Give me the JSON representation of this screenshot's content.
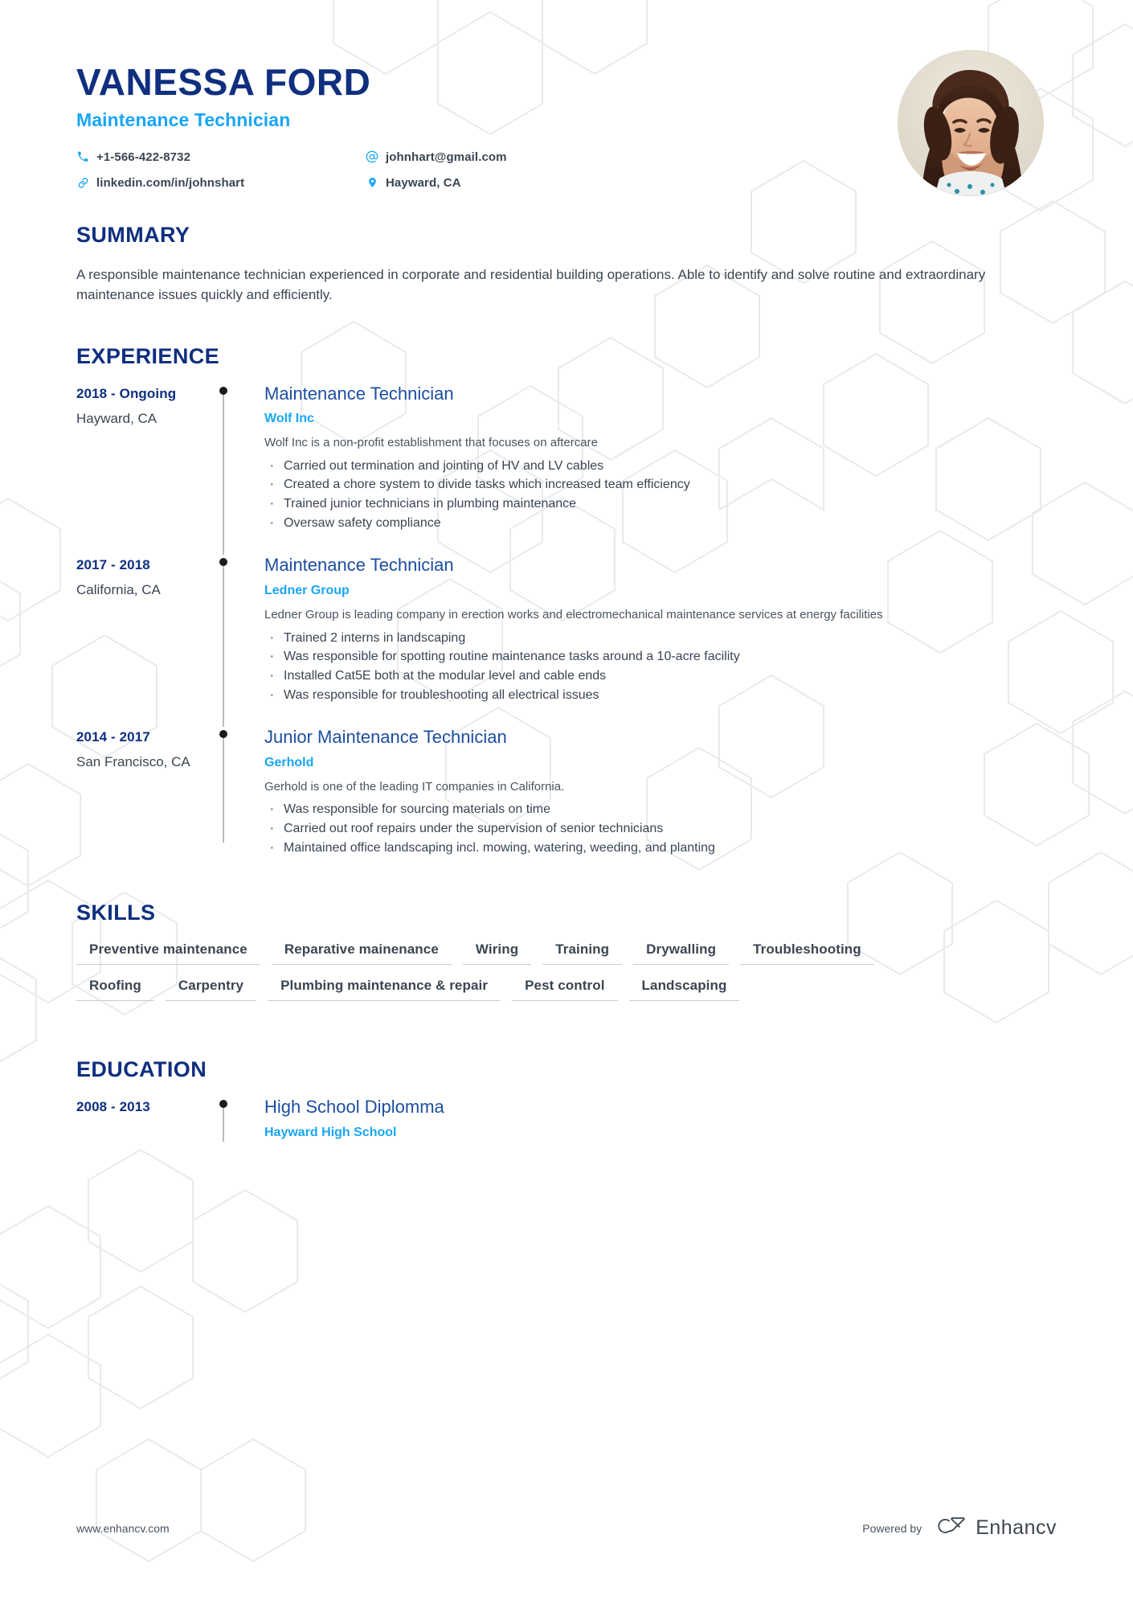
{
  "header": {
    "name": "VANESSA FORD",
    "job_title": "Maintenance Technician",
    "contacts": [
      {
        "icon": "phone-icon",
        "text": "+1-566-422-8732"
      },
      {
        "icon": "at-icon",
        "text": "johnhart@gmail.com"
      },
      {
        "icon": "link-icon",
        "text": "linkedin.com/in/johnshart"
      },
      {
        "icon": "location-pin-icon",
        "text": "Hayward, CA"
      }
    ],
    "photo_alt": "profile-photo"
  },
  "summary": {
    "title": "SUMMARY",
    "text": "A responsible maintenance technician experienced in corporate and residential building operations. Able to identify and solve routine and extraordinary maintenance issues quickly and efficiently."
  },
  "experience": {
    "title": "EXPERIENCE",
    "entries": [
      {
        "date": "2018 - Ongoing",
        "location": "Hayward, CA",
        "role": "Maintenance Technician",
        "company": "Wolf Inc",
        "description": "Wolf Inc is a non-profit establishment that focuses on aftercare",
        "bullets": [
          "Carried out termination and jointing of HV and LV cables",
          "Created a chore system to divide tasks which increased team efficiency",
          "Trained junior technicians in plumbing maintenance",
          "Oversaw safety compliance"
        ]
      },
      {
        "date": "2017 - 2018",
        "location": "California, CA",
        "role": "Maintenance Technician",
        "company": "Ledner Group",
        "description": "Ledner Group is leading company in erection works and electromechanical maintenance services at energy facilities",
        "bullets": [
          "Trained 2 interns in landscaping",
          "Was responsible for spotting routine maintenance tasks around a 10-acre facility",
          "Installed Cat5E both at the modular level and cable ends",
          "Was responsible for troubleshooting all electrical issues"
        ]
      },
      {
        "date": "2014 - 2017",
        "location": "San Francisco, CA",
        "role": "Junior Maintenance Technician",
        "company": "Gerhold",
        "description": "Gerhold is one of the leading IT companies in California.",
        "bullets": [
          "Was responsible for sourcing materials on time",
          "Carried out roof repairs under the supervision of senior technicians",
          "Maintained office landscaping incl. mowing, watering, weeding, and planting"
        ]
      }
    ]
  },
  "skills": {
    "title": "SKILLS",
    "rows": [
      [
        "Preventive maintenance",
        "Reparative mainenance",
        "Wiring",
        "Training",
        "Drywalling",
        "Troubleshooting"
      ],
      [
        "Roofing",
        "Carpentry",
        "Plumbing maintenance & repair",
        "Pest control",
        "Landscaping"
      ]
    ]
  },
  "education": {
    "title": "EDUCATION",
    "entries": [
      {
        "date": "2008 - 2013",
        "degree": "High School Diplomma",
        "school": "Hayward High School"
      }
    ]
  },
  "footer": {
    "url": "www.enhancv.com",
    "powered_by": "Powered by",
    "brand": "Enhancv"
  },
  "colors": {
    "navy": "#0f2f7f",
    "title_blue": "#1d4ea1",
    "accent_cyan": "#18a6f5",
    "body_text": "#3b4551",
    "hex_stroke": "#e9eaec"
  }
}
